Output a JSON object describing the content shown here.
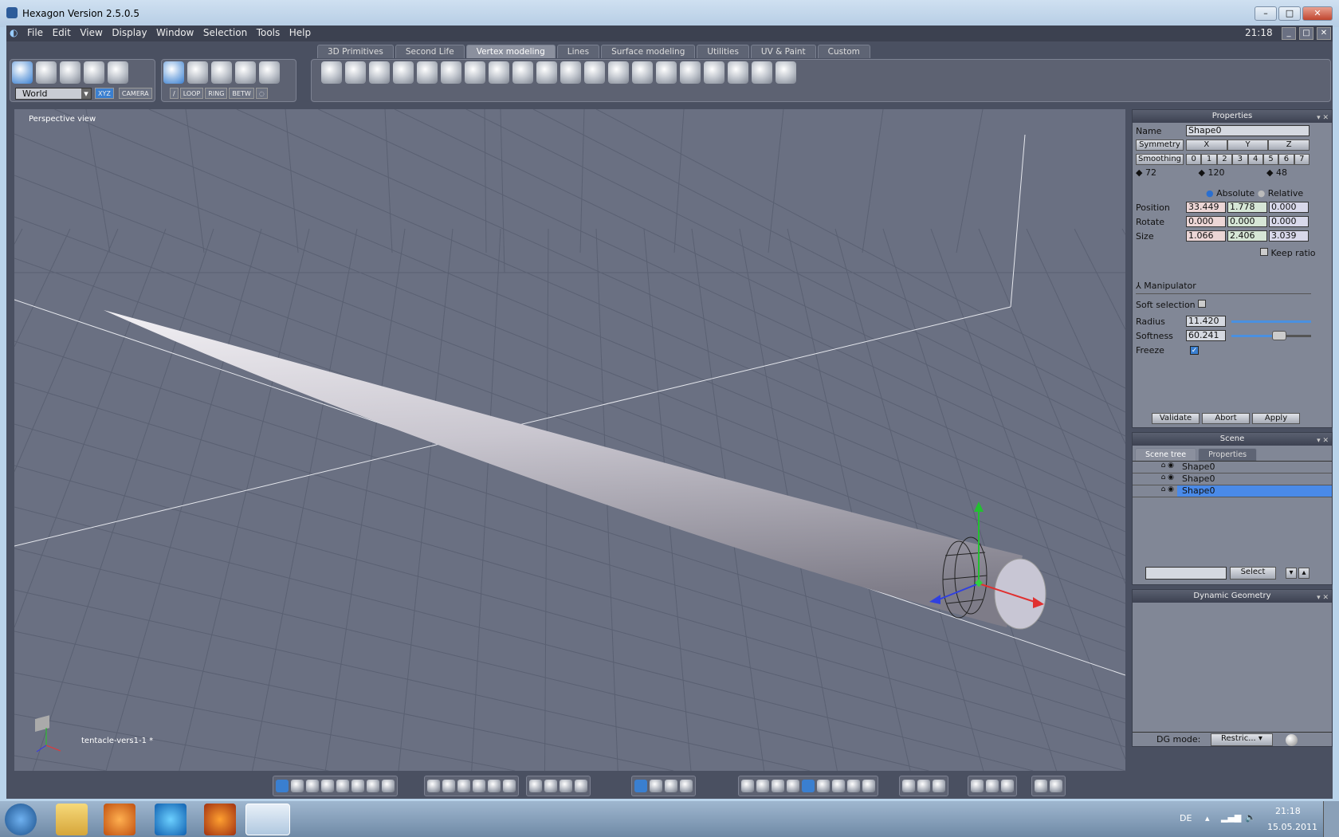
{
  "window": {
    "title": "Hexagon Version 2.5.0.5",
    "clock": "21:18"
  },
  "menu": [
    "File",
    "Edit",
    "Display",
    "Window",
    "Selection",
    "Tools",
    "Help"
  ],
  "menu_view": "View",
  "tabs": [
    "3D Primitives",
    "Second Life",
    "Vertex modeling",
    "Lines",
    "Surface modeling",
    "Utilities",
    "UV & Paint",
    "Custom"
  ],
  "active_tab": "Vertex modeling",
  "toolbar": {
    "coord_select": "World",
    "xyz": "XYZ",
    "camera": "CAMERA",
    "loop": "LOOP",
    "ring": "RING",
    "betw": "BETW"
  },
  "viewport": {
    "label": "Perspective view",
    "filename": "tentacle-vers1-1 *"
  },
  "properties": {
    "title": "Properties",
    "name_label": "Name",
    "name_value": "Shape0",
    "symmetry": "Symmetry",
    "axes": [
      "X",
      "Y",
      "Z"
    ],
    "smoothing": "Smoothing",
    "levels": [
      "0",
      "1",
      "2",
      "3",
      "4",
      "5",
      "6",
      "7"
    ],
    "counts": [
      "72",
      "120",
      "48"
    ],
    "absolute": "Absolute",
    "relative": "Relative",
    "position_label": "Position",
    "position": [
      "33.449",
      "1.778",
      "0.000"
    ],
    "rotate_label": "Rotate",
    "rotate": [
      "0.000",
      "0.000",
      "0.000"
    ],
    "size_label": "Size",
    "size": [
      "1.066",
      "2.406",
      "3.039"
    ],
    "keep_ratio": "Keep ratio",
    "manipulator": "Manipulator",
    "soft_selection": "Soft selection",
    "radius_label": "Radius",
    "radius": "11.420",
    "softness_label": "Softness",
    "softness": "60.241",
    "softness_fraction": 0.6,
    "freeze": "Freeze",
    "validate": "Validate",
    "abort": "Abort",
    "apply": "Apply"
  },
  "scene": {
    "title": "Scene",
    "tabs": [
      "Scene tree",
      "Properties"
    ],
    "items": [
      "Shape0",
      "Shape0",
      "Shape0"
    ],
    "select": "Select"
  },
  "dynamic": {
    "title": "Dynamic Geometry",
    "mode_label": "DG mode:",
    "mode": "Restric..."
  },
  "taskbar": {
    "lang": "DE",
    "time": "21:18",
    "date": "15.05.2011"
  }
}
